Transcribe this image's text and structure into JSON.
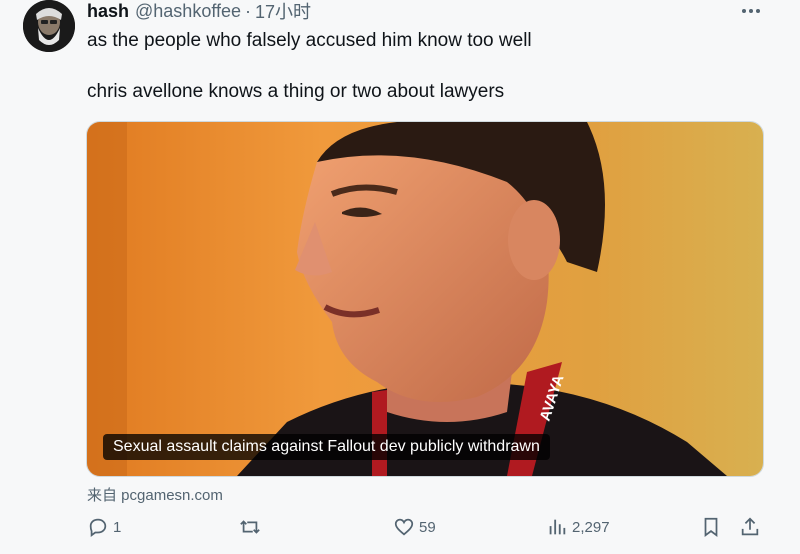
{
  "tweet": {
    "author_name": "hash",
    "author_handle": "@hashkoffee",
    "separator": "·",
    "time": "17小时",
    "more_icon": "ellipsis-icon",
    "text_line1": "as the people who falsely accused him know too well",
    "text_line2": "chris avellone knows a thing or two about lawyers",
    "media": {
      "caption": "Sexual assault claims against Fallout dev publicly withdrawn",
      "lanyard_text": "AVAYA"
    },
    "source": "来自 pcgamesn.com",
    "actions": {
      "replies": "1",
      "retweets": "",
      "likes": "59",
      "views": "2,297"
    }
  },
  "colors": {
    "text_primary": "#0f1419",
    "text_secondary": "#536471",
    "background": "#f7f8f9",
    "media_bg_orange": "#e8882a"
  }
}
